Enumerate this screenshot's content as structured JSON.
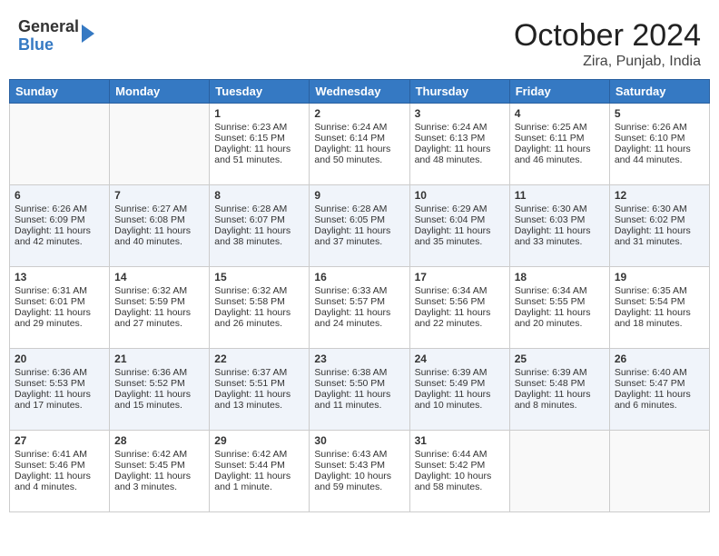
{
  "header": {
    "logo": {
      "line1": "General",
      "line2": "Blue"
    },
    "title": "October 2024",
    "location": "Zira, Punjab, India"
  },
  "days_of_week": [
    "Sunday",
    "Monday",
    "Tuesday",
    "Wednesday",
    "Thursday",
    "Friday",
    "Saturday"
  ],
  "weeks": [
    [
      {
        "day": "",
        "info": ""
      },
      {
        "day": "",
        "info": ""
      },
      {
        "day": "1",
        "info": "Sunrise: 6:23 AM\nSunset: 6:15 PM\nDaylight: 11 hours and 51 minutes."
      },
      {
        "day": "2",
        "info": "Sunrise: 6:24 AM\nSunset: 6:14 PM\nDaylight: 11 hours and 50 minutes."
      },
      {
        "day": "3",
        "info": "Sunrise: 6:24 AM\nSunset: 6:13 PM\nDaylight: 11 hours and 48 minutes."
      },
      {
        "day": "4",
        "info": "Sunrise: 6:25 AM\nSunset: 6:11 PM\nDaylight: 11 hours and 46 minutes."
      },
      {
        "day": "5",
        "info": "Sunrise: 6:26 AM\nSunset: 6:10 PM\nDaylight: 11 hours and 44 minutes."
      }
    ],
    [
      {
        "day": "6",
        "info": "Sunrise: 6:26 AM\nSunset: 6:09 PM\nDaylight: 11 hours and 42 minutes."
      },
      {
        "day": "7",
        "info": "Sunrise: 6:27 AM\nSunset: 6:08 PM\nDaylight: 11 hours and 40 minutes."
      },
      {
        "day": "8",
        "info": "Sunrise: 6:28 AM\nSunset: 6:07 PM\nDaylight: 11 hours and 38 minutes."
      },
      {
        "day": "9",
        "info": "Sunrise: 6:28 AM\nSunset: 6:05 PM\nDaylight: 11 hours and 37 minutes."
      },
      {
        "day": "10",
        "info": "Sunrise: 6:29 AM\nSunset: 6:04 PM\nDaylight: 11 hours and 35 minutes."
      },
      {
        "day": "11",
        "info": "Sunrise: 6:30 AM\nSunset: 6:03 PM\nDaylight: 11 hours and 33 minutes."
      },
      {
        "day": "12",
        "info": "Sunrise: 6:30 AM\nSunset: 6:02 PM\nDaylight: 11 hours and 31 minutes."
      }
    ],
    [
      {
        "day": "13",
        "info": "Sunrise: 6:31 AM\nSunset: 6:01 PM\nDaylight: 11 hours and 29 minutes."
      },
      {
        "day": "14",
        "info": "Sunrise: 6:32 AM\nSunset: 5:59 PM\nDaylight: 11 hours and 27 minutes."
      },
      {
        "day": "15",
        "info": "Sunrise: 6:32 AM\nSunset: 5:58 PM\nDaylight: 11 hours and 26 minutes."
      },
      {
        "day": "16",
        "info": "Sunrise: 6:33 AM\nSunset: 5:57 PM\nDaylight: 11 hours and 24 minutes."
      },
      {
        "day": "17",
        "info": "Sunrise: 6:34 AM\nSunset: 5:56 PM\nDaylight: 11 hours and 22 minutes."
      },
      {
        "day": "18",
        "info": "Sunrise: 6:34 AM\nSunset: 5:55 PM\nDaylight: 11 hours and 20 minutes."
      },
      {
        "day": "19",
        "info": "Sunrise: 6:35 AM\nSunset: 5:54 PM\nDaylight: 11 hours and 18 minutes."
      }
    ],
    [
      {
        "day": "20",
        "info": "Sunrise: 6:36 AM\nSunset: 5:53 PM\nDaylight: 11 hours and 17 minutes."
      },
      {
        "day": "21",
        "info": "Sunrise: 6:36 AM\nSunset: 5:52 PM\nDaylight: 11 hours and 15 minutes."
      },
      {
        "day": "22",
        "info": "Sunrise: 6:37 AM\nSunset: 5:51 PM\nDaylight: 11 hours and 13 minutes."
      },
      {
        "day": "23",
        "info": "Sunrise: 6:38 AM\nSunset: 5:50 PM\nDaylight: 11 hours and 11 minutes."
      },
      {
        "day": "24",
        "info": "Sunrise: 6:39 AM\nSunset: 5:49 PM\nDaylight: 11 hours and 10 minutes."
      },
      {
        "day": "25",
        "info": "Sunrise: 6:39 AM\nSunset: 5:48 PM\nDaylight: 11 hours and 8 minutes."
      },
      {
        "day": "26",
        "info": "Sunrise: 6:40 AM\nSunset: 5:47 PM\nDaylight: 11 hours and 6 minutes."
      }
    ],
    [
      {
        "day": "27",
        "info": "Sunrise: 6:41 AM\nSunset: 5:46 PM\nDaylight: 11 hours and 4 minutes."
      },
      {
        "day": "28",
        "info": "Sunrise: 6:42 AM\nSunset: 5:45 PM\nDaylight: 11 hours and 3 minutes."
      },
      {
        "day": "29",
        "info": "Sunrise: 6:42 AM\nSunset: 5:44 PM\nDaylight: 11 hours and 1 minute."
      },
      {
        "day": "30",
        "info": "Sunrise: 6:43 AM\nSunset: 5:43 PM\nDaylight: 10 hours and 59 minutes."
      },
      {
        "day": "31",
        "info": "Sunrise: 6:44 AM\nSunset: 5:42 PM\nDaylight: 10 hours and 58 minutes."
      },
      {
        "day": "",
        "info": ""
      },
      {
        "day": "",
        "info": ""
      }
    ]
  ]
}
